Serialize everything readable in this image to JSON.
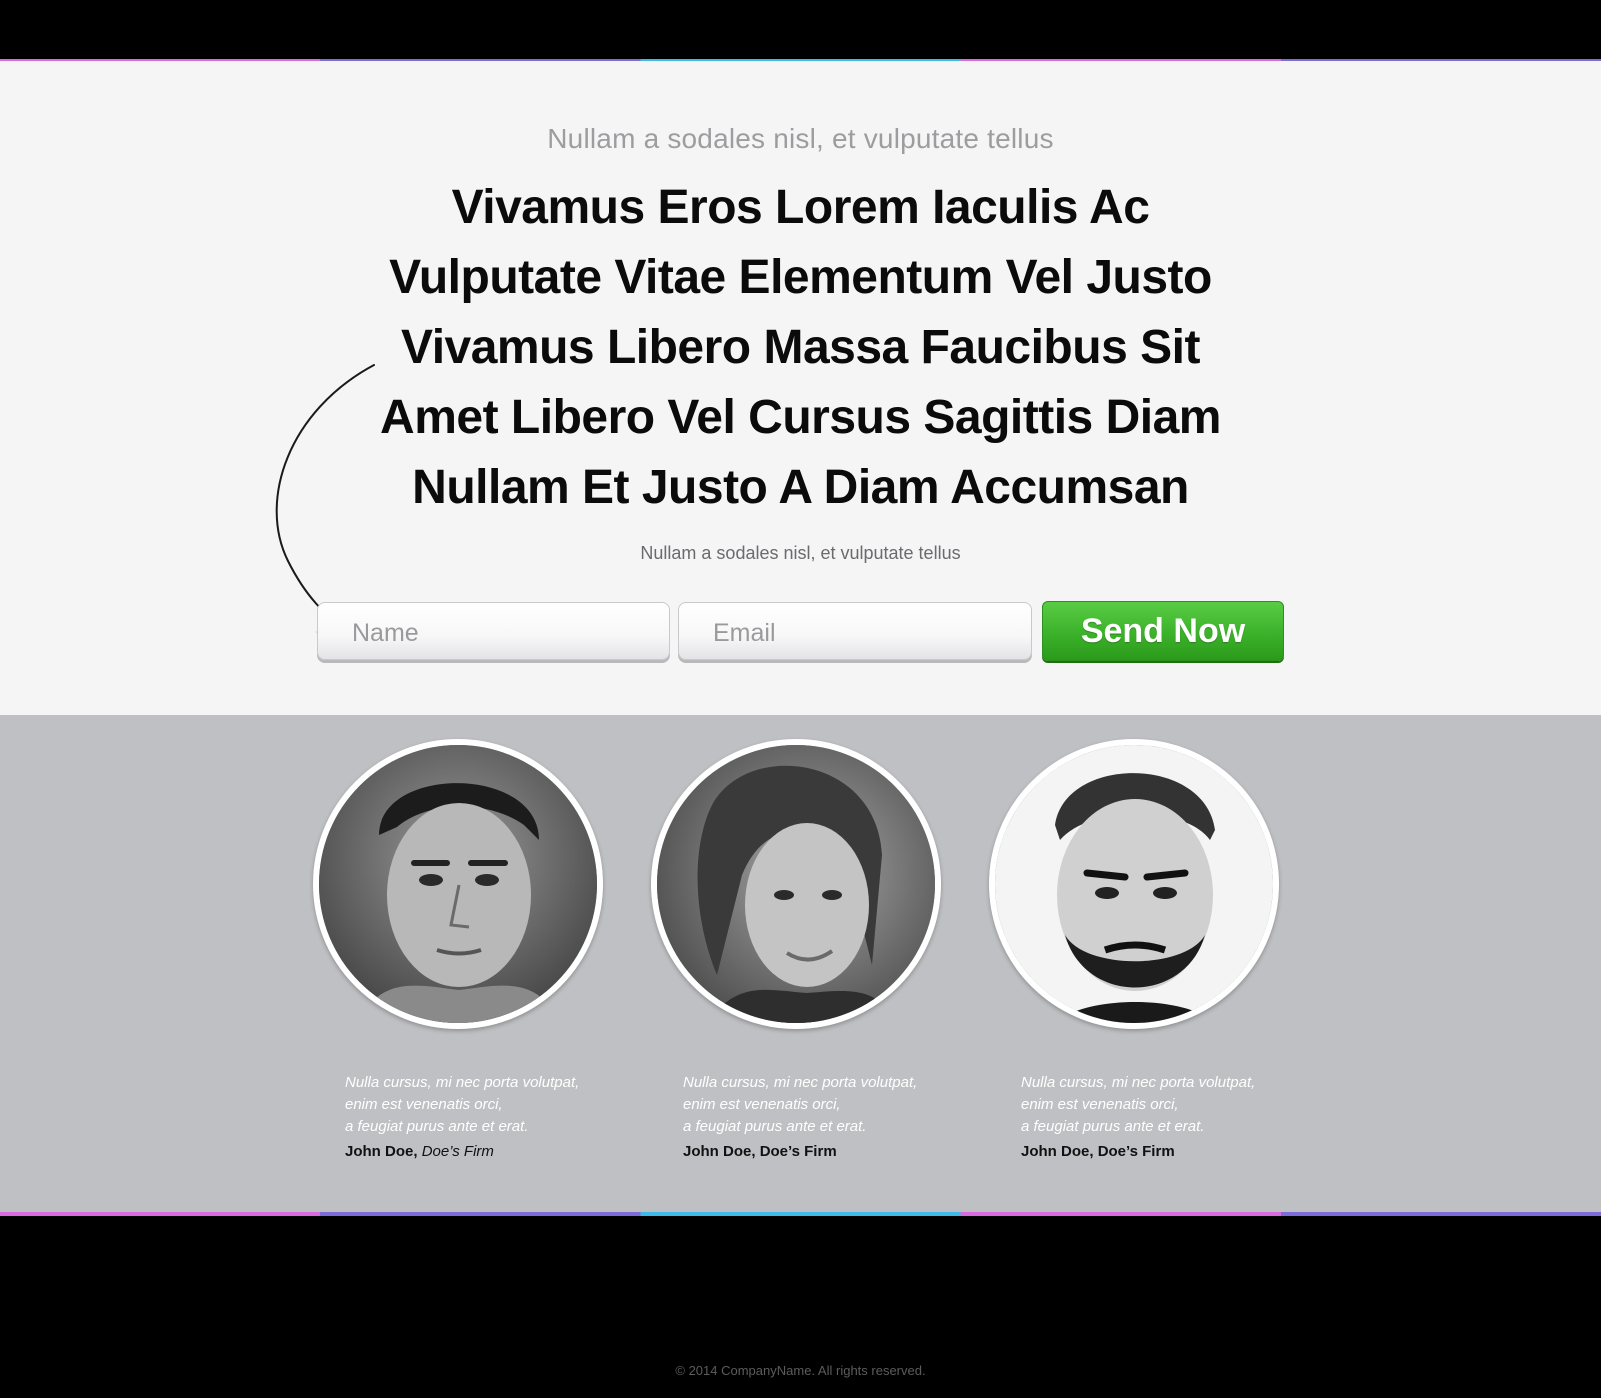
{
  "hero": {
    "kicker": "Nullam a sodales nisl, et vulputate tellus",
    "headline": [
      "Vivamus Eros Lorem Iaculis Ac",
      "Vulputate Vitae Elementum Vel Justo",
      "Vivamus Libero Massa Faucibus Sit",
      "Amet Libero Vel Cursus Sagittis Diam",
      "Nullam Et Justo A Diam Accumsan"
    ],
    "subtext": "Nullam a sodales nisl, et vulputate tellus"
  },
  "form": {
    "name_placeholder": "Name",
    "email_placeholder": "Email",
    "submit_label": "Send Now",
    "submit_color": "#3eb42c"
  },
  "testimonials": [
    {
      "quote": [
        "Nulla cursus, mi nec porta volutpat,",
        "enim est venenatis orci,",
        "a feugiat purus ante et erat."
      ],
      "name": "John Doe,",
      "firm": "Doe’s Firm"
    },
    {
      "quote": [
        "Nulla cursus, mi nec porta volutpat,",
        "enim est venenatis orci,",
        "a feugiat purus ante et erat."
      ],
      "name": "John Doe,",
      "firm": "Doe’s Firm"
    },
    {
      "quote": [
        "Nulla cursus, mi nec porta volutpat,",
        "enim est venenatis orci,",
        "a feugiat purus ante et erat."
      ],
      "name": "John Doe,",
      "firm": "Doe’s Firm"
    }
  ],
  "footer": {
    "copyright": "© 2014 CompanyName. All rights reserved."
  },
  "colors": {
    "accent_pink": "#d96adf",
    "accent_purple": "#7e6ad9",
    "accent_blue": "#3fb9e6",
    "hero_bg": "#f5f5f6",
    "team_bg": "#bec0c3"
  }
}
